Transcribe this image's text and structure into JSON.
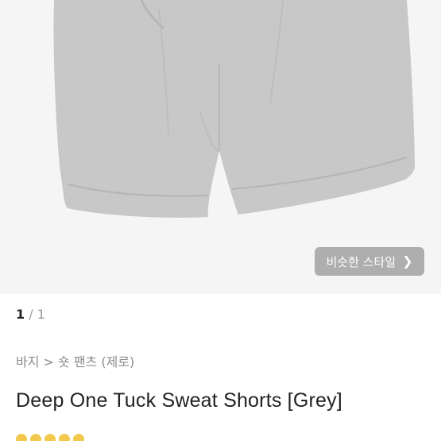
{
  "product_image": {
    "alt": ""
  },
  "similar_style_button": {
    "label": "비슷한 스타일",
    "icon": "chevron-right-icon"
  },
  "image_counter": {
    "current": "1",
    "separator": "/",
    "total": "1"
  },
  "breadcrumb": "바지 > 숏 팬츠 (제로)",
  "product_title": "Deep One Tuck Sweat Shorts [Grey]",
  "rating": {
    "stars_visible": 5,
    "color": "#f2c94c"
  },
  "colors": {
    "fabric": "#c9c9c9",
    "hero_bg": "#f5f5f5",
    "button_bg": "#a9a9a9"
  }
}
